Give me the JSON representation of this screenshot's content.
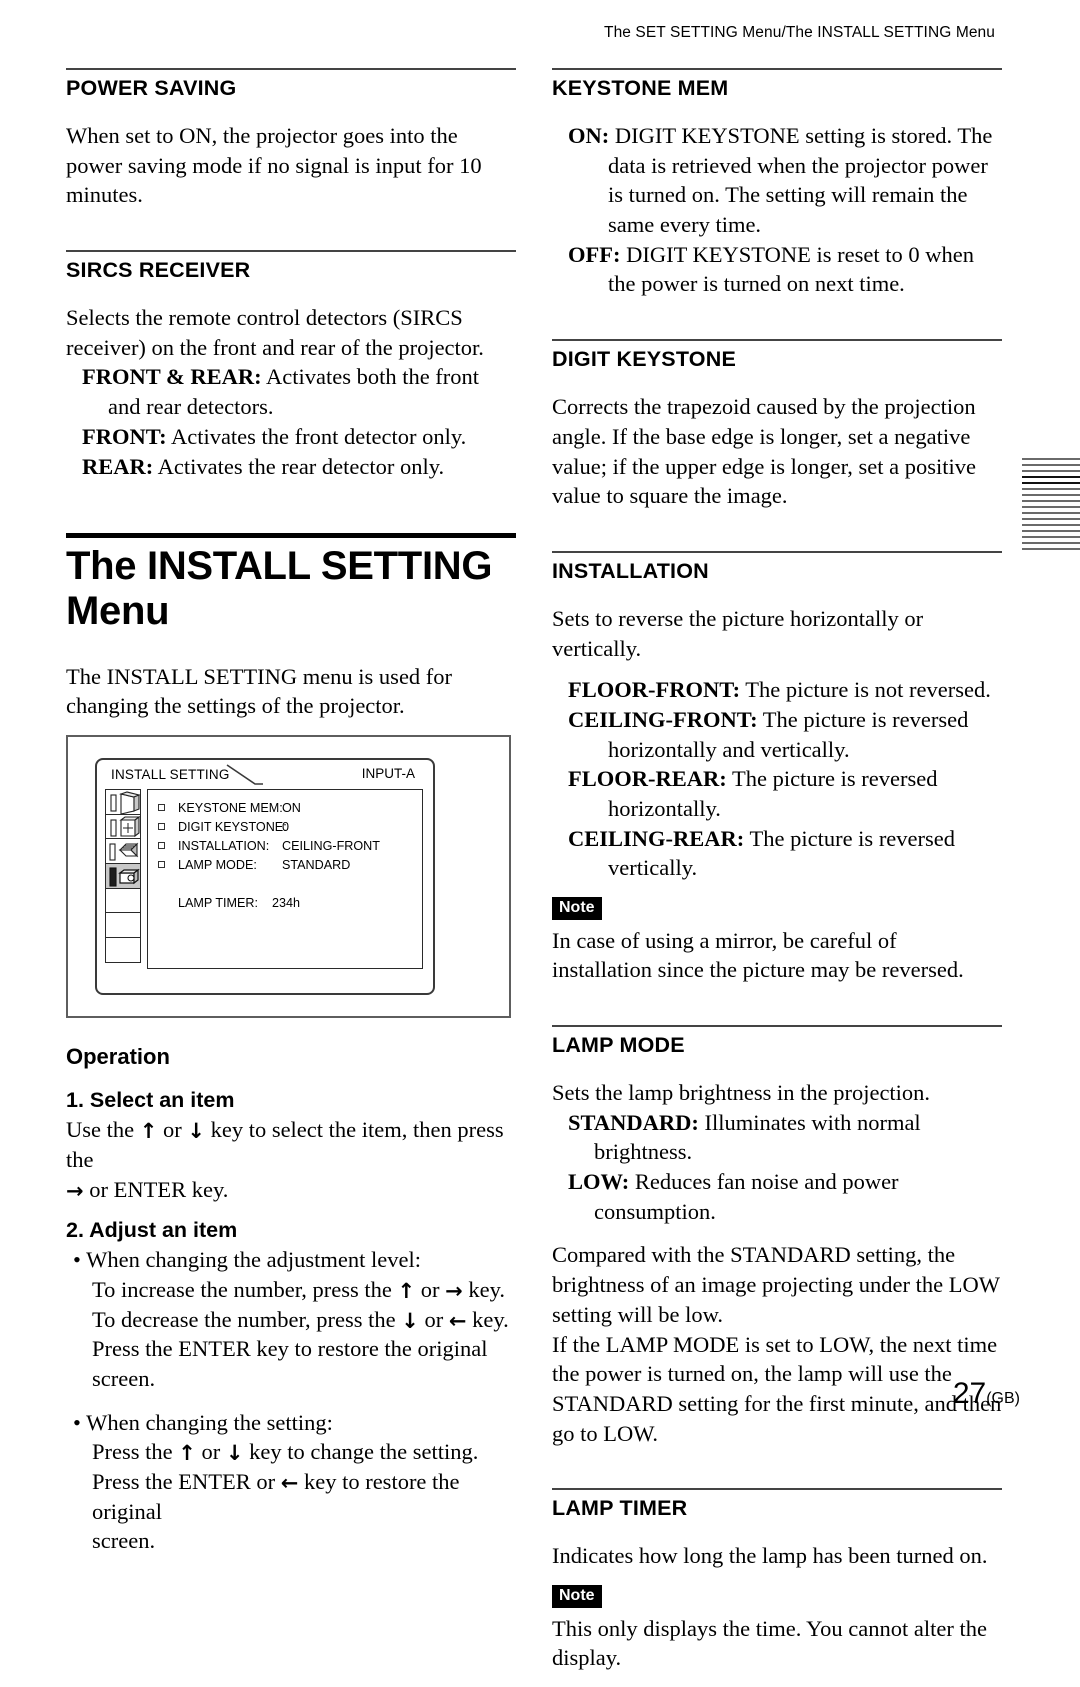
{
  "running_head": "The SET SETTING Menu/The INSTALL SETTING Menu",
  "left_column": {
    "power_saving": {
      "heading": "POWER SAVING",
      "body": "When set to ON, the projector goes into the power saving mode if no signal is input for 10 minutes."
    },
    "sircs_receiver": {
      "heading": "SIRCS RECEIVER",
      "body": "Selects the remote control detectors (SIRCS receiver) on the front and rear of the projector.",
      "options": [
        {
          "term": "FRONT & REAR:",
          "desc": " Activates both the front and rear detectors."
        },
        {
          "term": "FRONT:",
          "desc": " Activates the front detector only."
        },
        {
          "term": "REAR:",
          "desc": " Activates the rear detector only."
        }
      ]
    },
    "chapter": {
      "title": "The INSTALL SETTING Menu",
      "intro": "The INSTALL SETTING menu is used for changing the settings of the projector."
    },
    "osd_figure": {
      "menu_title": "INSTALL SETTING",
      "input_label": "INPUT-A",
      "rows": [
        {
          "label": "KEYSTONE MEM:",
          "value": "ON"
        },
        {
          "label": "DIGIT KEYSTONE:",
          "value": "0"
        },
        {
          "label": "INSTALLATION:",
          "value": "CEILING-FRONT"
        },
        {
          "label": "LAMP MODE:",
          "value": "STANDARD"
        }
      ],
      "timer_label": "LAMP TIMER:",
      "timer_value": "234h"
    },
    "operation": {
      "title": "Operation",
      "step1": {
        "heading": "1. Select an item",
        "line1_pre": "Use the ",
        "up": "↑",
        "line1_mid": " or ",
        "down": "↓",
        "line1_post": " key to select the item, then press the",
        "line2_arrow": "→",
        "line2_post": " or ENTER key."
      },
      "step2": {
        "heading": "2. Adjust an item",
        "bullet1": "• When changing the adjustment level:",
        "b1_line1_pre": "To increase the number, press the ",
        "b1_line1_mid": " or ",
        "b1_line1_post": " key.",
        "b1_line2_pre": "To decrease the number, press the ",
        "b1_line2_mid": " or ",
        "b1_line2_post": " key.",
        "b1_line3": "Press the ENTER key to restore the original screen.",
        "bullet2": "• When changing the setting:",
        "b2_line1_pre": "Press the ",
        "b2_line1_mid": " or ",
        "b2_line1_post": " key to change the setting.",
        "b2_line2_pre": "Press the ENTER or ",
        "b2_line2_post": " key to restore the original",
        "b2_line3": "screen.",
        "up": "↑",
        "down": "↓",
        "right": "→",
        "left": "←"
      }
    }
  },
  "right_column": {
    "keystone_mem": {
      "heading": "KEYSTONE MEM",
      "options": [
        {
          "term": "ON:",
          "desc": " DIGIT KEYSTONE setting is stored. The data is retrieved when the projector power is turned on. The setting will remain the same every time."
        },
        {
          "term": "OFF:",
          "desc": " DIGIT KEYSTONE is reset to 0 when the power is turned on next time."
        }
      ]
    },
    "digit_keystone": {
      "heading": "DIGIT KEYSTONE",
      "body": "Corrects the trapezoid caused by the projection angle. If the base edge is longer,  set a negative value; if the upper edge is longer, set a positive value to square the image."
    },
    "installation": {
      "heading": "INSTALLATION",
      "body": "Sets to reverse the picture horizontally or vertically.",
      "options": [
        {
          "term": "FLOOR-FRONT:",
          "desc": " The picture is not reversed."
        },
        {
          "term": "CEILING-FRONT:",
          "desc": " The picture is reversed horizontally and vertically."
        },
        {
          "term": "FLOOR-REAR:",
          "desc": " The picture is reversed horizontally."
        },
        {
          "term": "CEILING-REAR:",
          "desc": " The picture is reversed vertically."
        }
      ],
      "note_badge": "Note",
      "note_text": "In case of using a mirror, be careful of installation since the picture may be reversed."
    },
    "lamp_mode": {
      "heading": "LAMP MODE",
      "body": "Sets the lamp brightness in the projection.",
      "options": [
        {
          "term": "STANDARD:",
          "desc": " Illuminates with normal brightness."
        },
        {
          "term": "LOW:",
          "desc": " Reduces fan noise and power consumption."
        }
      ],
      "para2": "Compared with the STANDARD setting, the brightness of an image projecting under the LOW setting will be low.",
      "para3": "If the LAMP MODE is set to LOW, the next time the power is turned on, the lamp will use the STANDARD setting for the first minute, and then go to LOW."
    },
    "lamp_timer": {
      "heading": "LAMP TIMER",
      "body": "Indicates how long the lamp has been turned on.",
      "note_badge": "Note",
      "note_text": "This only displays the time.  You cannot alter the display."
    }
  },
  "page_number": {
    "num": "27",
    "suffix": "(GB)"
  }
}
